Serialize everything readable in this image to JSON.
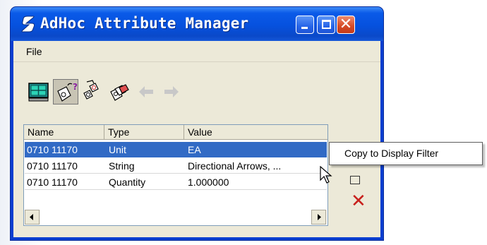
{
  "window": {
    "title": "AdHoc Attribute Manager",
    "controls": [
      "minimize-icon",
      "maximize-icon",
      "close-icon"
    ]
  },
  "menubar": {
    "items": [
      "File"
    ]
  },
  "toolbar": {
    "buttons": [
      {
        "icon": "display-grid-icon",
        "pressed": false
      },
      {
        "icon": "attribute-query-icon",
        "pressed": true
      },
      {
        "icon": "attribute-copy-icon",
        "pressed": false
      },
      {
        "icon": "attribute-stack-icon",
        "pressed": false
      },
      {
        "icon": "arrow-left-icon",
        "enabled": false
      },
      {
        "icon": "arrow-right-icon",
        "enabled": false
      }
    ]
  },
  "attribute_list": {
    "columns": [
      "Name",
      "Type",
      "Value"
    ],
    "rows": [
      {
        "name": "0710 11170",
        "type": "Unit",
        "value": "EA",
        "selected": true
      },
      {
        "name": "0710 11170",
        "type": "String",
        "value": "Directional Arrows, ...",
        "selected": false
      },
      {
        "name": "0710 11170",
        "type": "Quantity",
        "value": "1.000000",
        "selected": false
      }
    ]
  },
  "context_menu": {
    "items": [
      "Copy to Display Filter"
    ]
  },
  "colors": {
    "title_bar": "#0a5ae8",
    "selection": "#316ac5",
    "window_face": "#ece9d8",
    "delete_red": "#c8201c"
  }
}
